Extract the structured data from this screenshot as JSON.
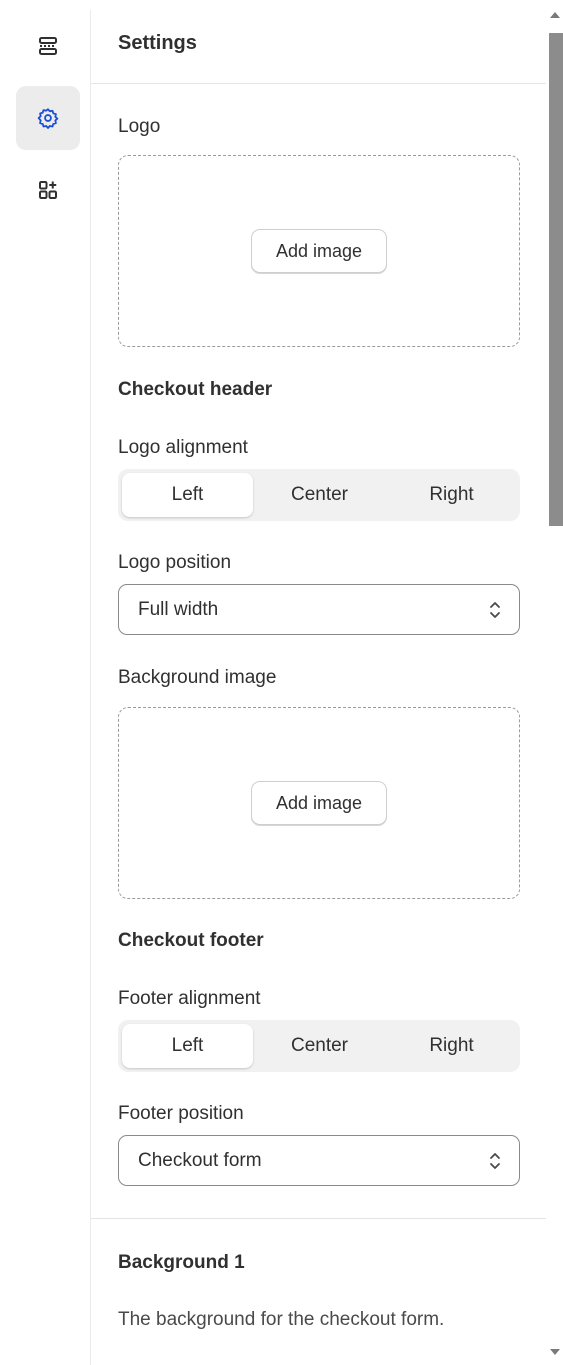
{
  "rail": {
    "items": [
      {
        "icon": "sections-icon",
        "active": false
      },
      {
        "icon": "gear-icon",
        "active": true
      },
      {
        "icon": "add-app-block-icon",
        "active": false
      }
    ]
  },
  "panel": {
    "title": "Settings",
    "logo": {
      "label": "Logo",
      "add_image_label": "Add image"
    },
    "checkout_header": {
      "title": "Checkout header",
      "alignment_label": "Logo alignment",
      "alignment_options": [
        "Left",
        "Center",
        "Right"
      ],
      "alignment_selected": "Left",
      "position_label": "Logo position",
      "position_value": "Full width",
      "background_image_label": "Background image",
      "add_image_label": "Add image"
    },
    "checkout_footer": {
      "title": "Checkout footer",
      "alignment_label": "Footer alignment",
      "alignment_options": [
        "Left",
        "Center",
        "Right"
      ],
      "alignment_selected": "Left",
      "position_label": "Footer position",
      "position_value": "Checkout form"
    },
    "background": {
      "title": "Background 1",
      "description": "The background for the checkout form."
    }
  },
  "colors": {
    "text": "#303030",
    "border_dashed": "#9b9b9b",
    "segment_bg": "#f1f1f1",
    "active_rail_bg": "#ececec"
  }
}
